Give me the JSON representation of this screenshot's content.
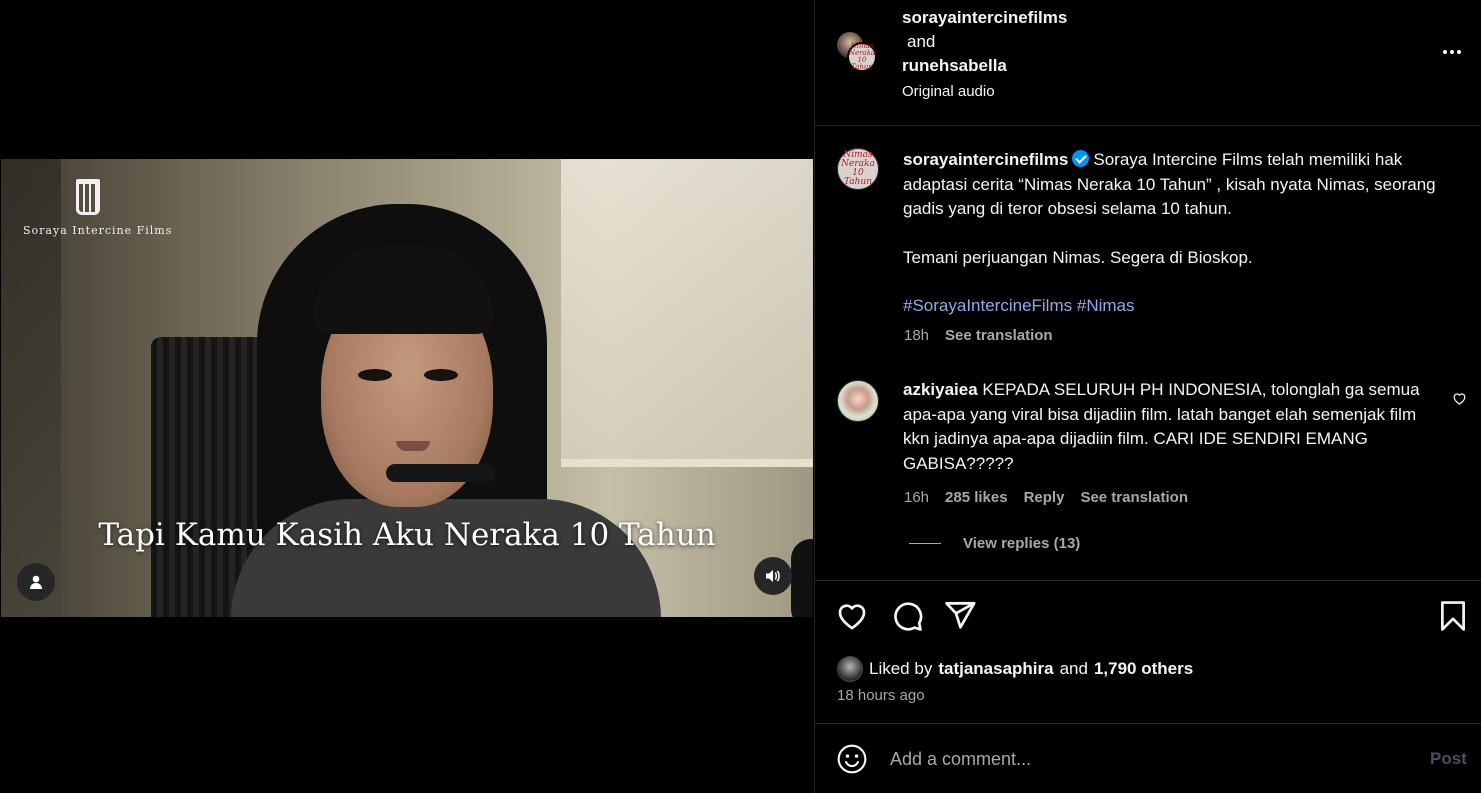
{
  "video": {
    "logo_text": "Soraya Intercine Films",
    "subtitle": "Tapi Kamu Kasih Aku Neraka 10 Tahun"
  },
  "header": {
    "user1": "sorayaintercinefilms",
    "connector": "and",
    "user2": "runehsabella",
    "audio": "Original audio"
  },
  "caption": {
    "username": "sorayaintercinefilms",
    "text": "Soraya Intercine Films telah memiliki hak adaptasi cerita “Nimas Neraka 10 Tahun” , kisah nyata Nimas, seorang gadis yang di teror obsesi selama 10 tahun.",
    "line2": "Temani perjuangan Nimas. Segera di Bioskop.",
    "hashtag1": "#SorayaIntercineFilms",
    "hashtag2": "#Nimas",
    "time": "18h",
    "see_translation": "See translation",
    "avatar_text": "Nimas Neraka 10 Tahun"
  },
  "comment": {
    "username": "azkiyaiea",
    "text": "KEPADA SELURUH PH INDONESIA, tolonglah ga semua apa-apa yang viral bisa dijadiin film. latah banget elah semenjak film kkn jadinya apa-apa dijadiin film. CARI IDE SENDIRI EMANG GABISA?????",
    "time": "16h",
    "likes": "285 likes",
    "reply": "Reply",
    "see_translation": "See translation",
    "view_replies": "View replies (13)"
  },
  "likes": {
    "prefix": "Liked by",
    "user": "tatjanasaphira",
    "and": "and",
    "others": "1,790 others",
    "time_ago": "18 hours ago"
  },
  "add_comment": {
    "placeholder": "Add a comment...",
    "post": "Post"
  },
  "colors": {
    "accent_blue": "#0095f6",
    "hashtag": "#95a8e8",
    "muted": "#a8a8a8",
    "post_disabled": "#445066"
  },
  "icons": [
    "user-tag-icon",
    "speaker-icon",
    "more-icon",
    "verified-icon",
    "heart-icon",
    "comment-icon",
    "share-icon",
    "bookmark-icon",
    "emoji-icon"
  ]
}
